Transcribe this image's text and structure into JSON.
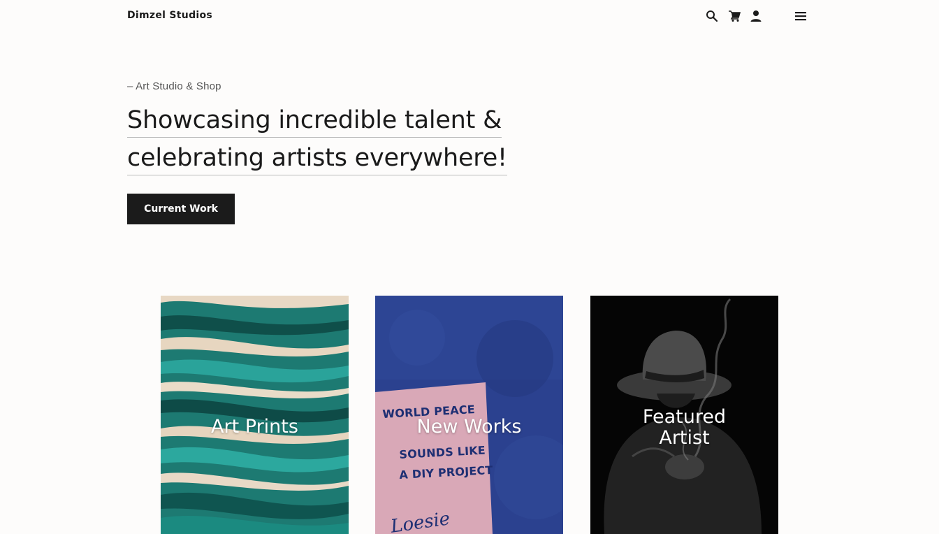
{
  "header": {
    "brand": "Dimzel Studios",
    "icons": [
      "search-icon",
      "cart-icon",
      "account-icon",
      "menu-icon"
    ]
  },
  "hero": {
    "eyebrow": "– Art Studio & Shop",
    "headline_line1": "Showcasing incredible talent &",
    "headline_line2": "celebrating artists everywhere!",
    "cta_label": "Current Work"
  },
  "cards": [
    {
      "title": "Art Prints"
    },
    {
      "title": "New Works",
      "poster_line1": "WORLD PEACE",
      "poster_line2": "SOUNDS LIKE",
      "poster_line3": "A DIY PROJECT",
      "poster_signature": "Loesie"
    },
    {
      "title_line1": "Featured",
      "title_line2": "Artist"
    }
  ],
  "colors": {
    "background": "#fdfcfb",
    "button": "#1b1b1b",
    "teal": "#1f7f77",
    "blue": "#2a3f8f",
    "pink": "#d9a9b8",
    "black": "#050505"
  }
}
